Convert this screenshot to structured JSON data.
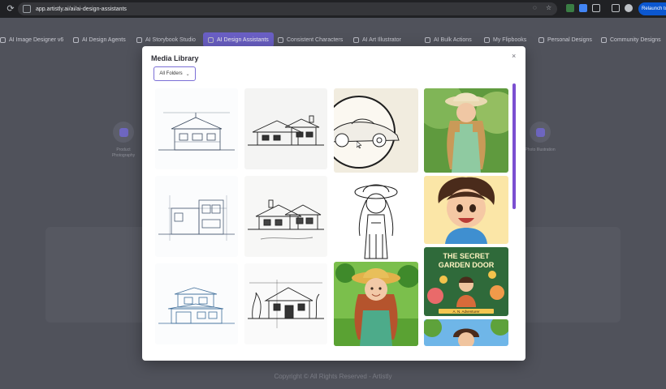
{
  "browser": {
    "url": "app.artistly.ai/ai/ai-design-assistants",
    "relaunch_label": "Relaunch to update"
  },
  "nav": {
    "items": [
      {
        "label": "AI Image Designer v6"
      },
      {
        "label": "AI Design Agents"
      },
      {
        "label": "AI Storybook Studio"
      },
      {
        "label": "AI Design Assistants"
      },
      {
        "label": "Consistent Characters"
      },
      {
        "label": "AI Art Illustrator"
      },
      {
        "label": "AI Bulk Actions"
      },
      {
        "label": "My Flipbooks"
      },
      {
        "label": "Personal Designs"
      },
      {
        "label": "Community Designs"
      }
    ],
    "active_index": 3
  },
  "background": {
    "feature_left": "Product Photography",
    "feature_right": "Photo Illustration"
  },
  "footer": {
    "text": "Copyright © All Rights Reserved - Artistly"
  },
  "modal": {
    "title": "Media Library",
    "close_glyph": "×",
    "folder_select": {
      "value": "All Folders"
    },
    "book_cover": {
      "title_line1": "THE SECRET",
      "title_line2": "GARDEN DOOR",
      "author": "A. N. Adventurer"
    }
  },
  "colors": {
    "accent": "#7b4fd1",
    "active_tab": "#6a5fc4",
    "overlay": "#4a4c55"
  }
}
